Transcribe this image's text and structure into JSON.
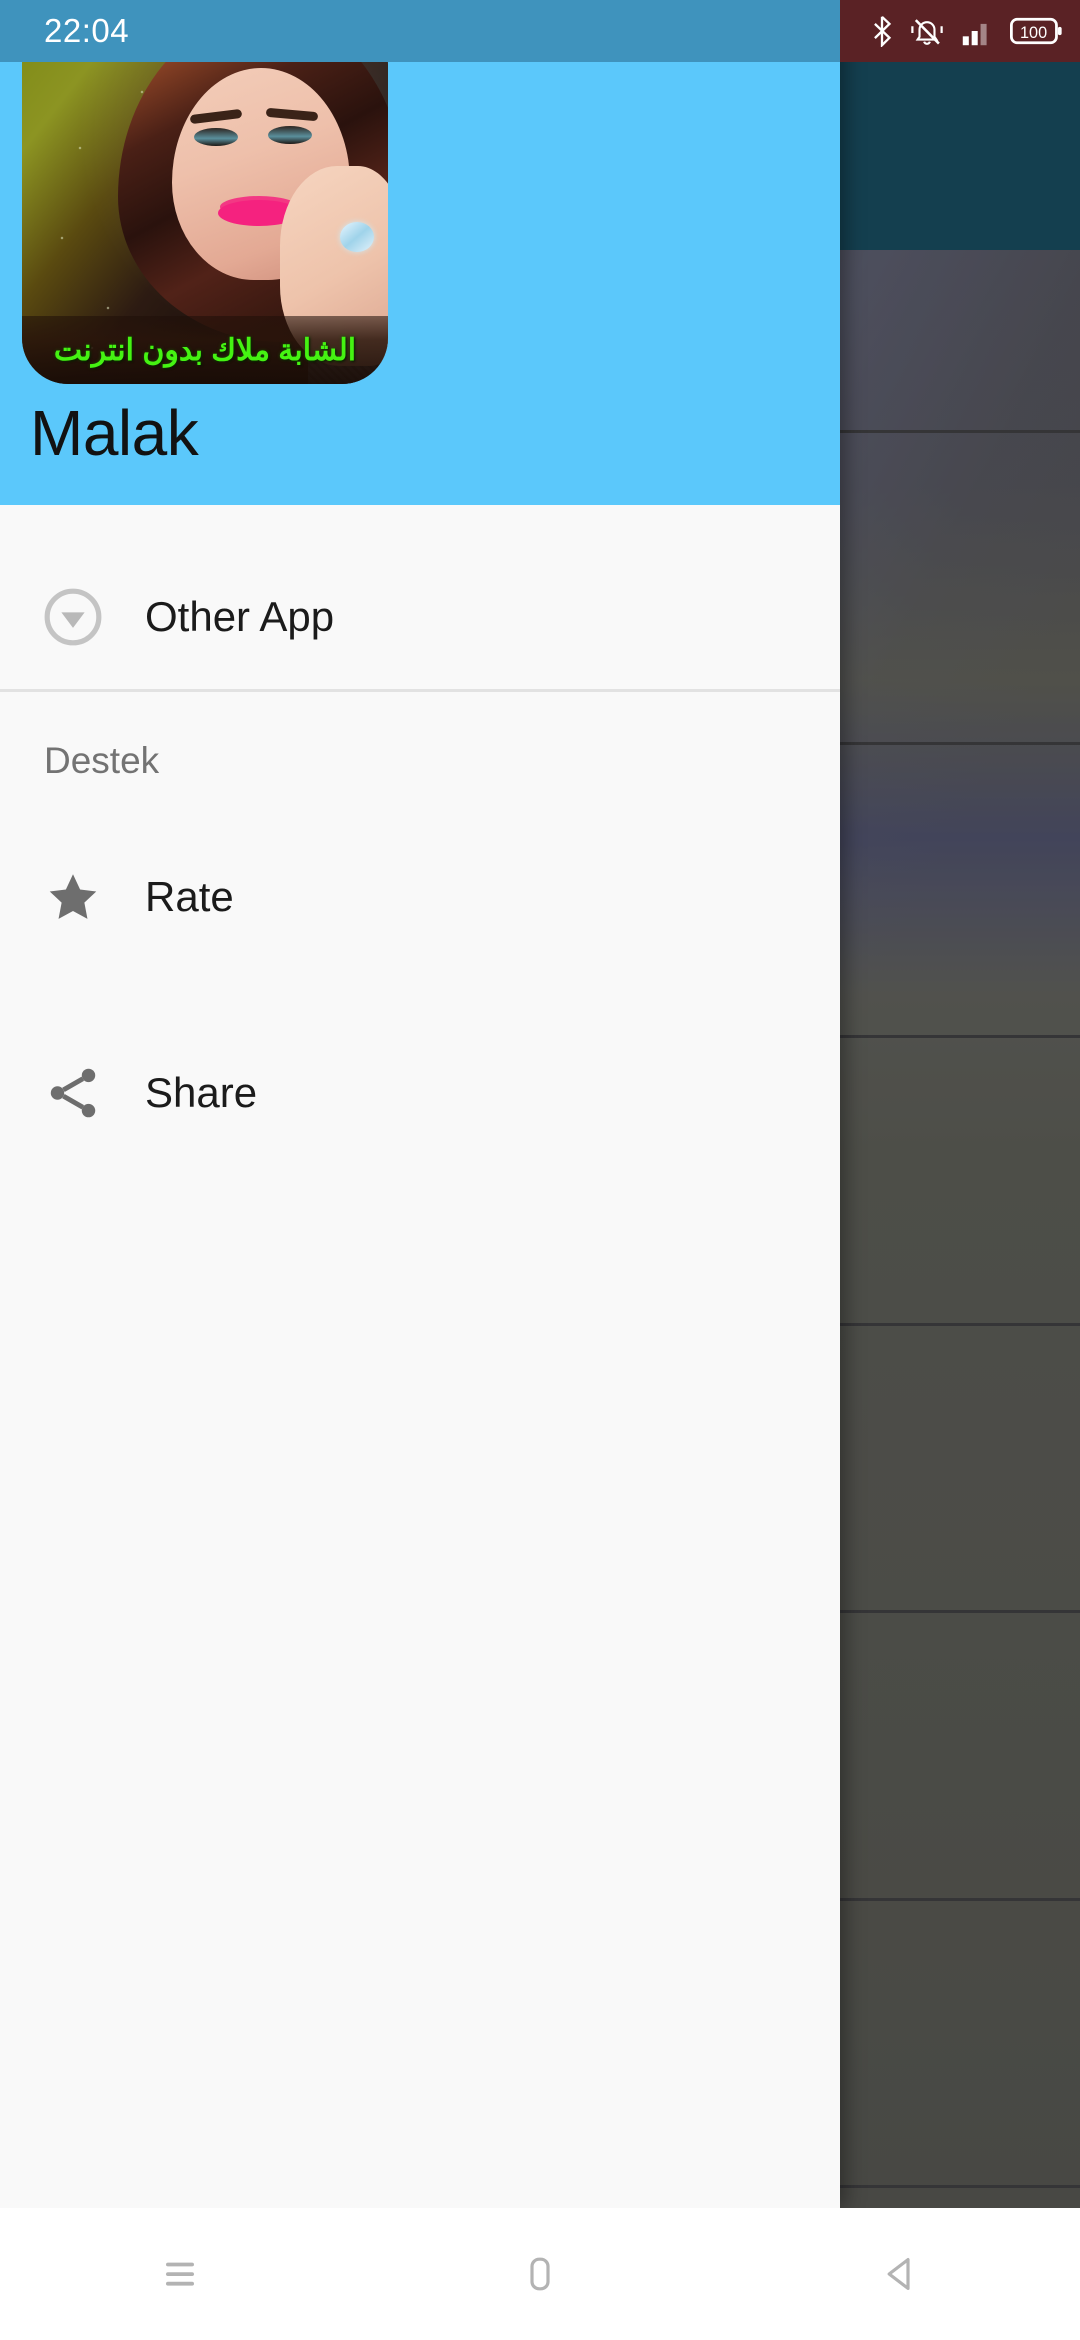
{
  "status_bar": {
    "clock": "22:04",
    "icons": [
      "bluetooth-icon",
      "ringer-mute-icon",
      "signal-bars-icon",
      "battery-icon"
    ],
    "battery_level": "100",
    "left_bg_color": "#3f93bd",
    "right_bg_color": "#5a2225"
  },
  "drawer": {
    "header": {
      "title": "Malak",
      "background_color": "#5bc8fb",
      "app_icon": {
        "name": "app-icon-malak",
        "caption_text": "الشابة ملاك بدون انترنت",
        "caption_color": "#45f312"
      }
    },
    "items": [
      {
        "label": "Other App",
        "icon": "circle-arrow-down-icon"
      }
    ],
    "section_header": "Destek",
    "support_items": [
      {
        "label": "Rate",
        "icon": "star-icon"
      },
      {
        "label": "Share",
        "icon": "share-icon"
      }
    ],
    "background_color": "#f9f9f9"
  },
  "navigation_bar": {
    "recents_label": "recent-apps",
    "home_label": "home",
    "back_label": "back"
  }
}
